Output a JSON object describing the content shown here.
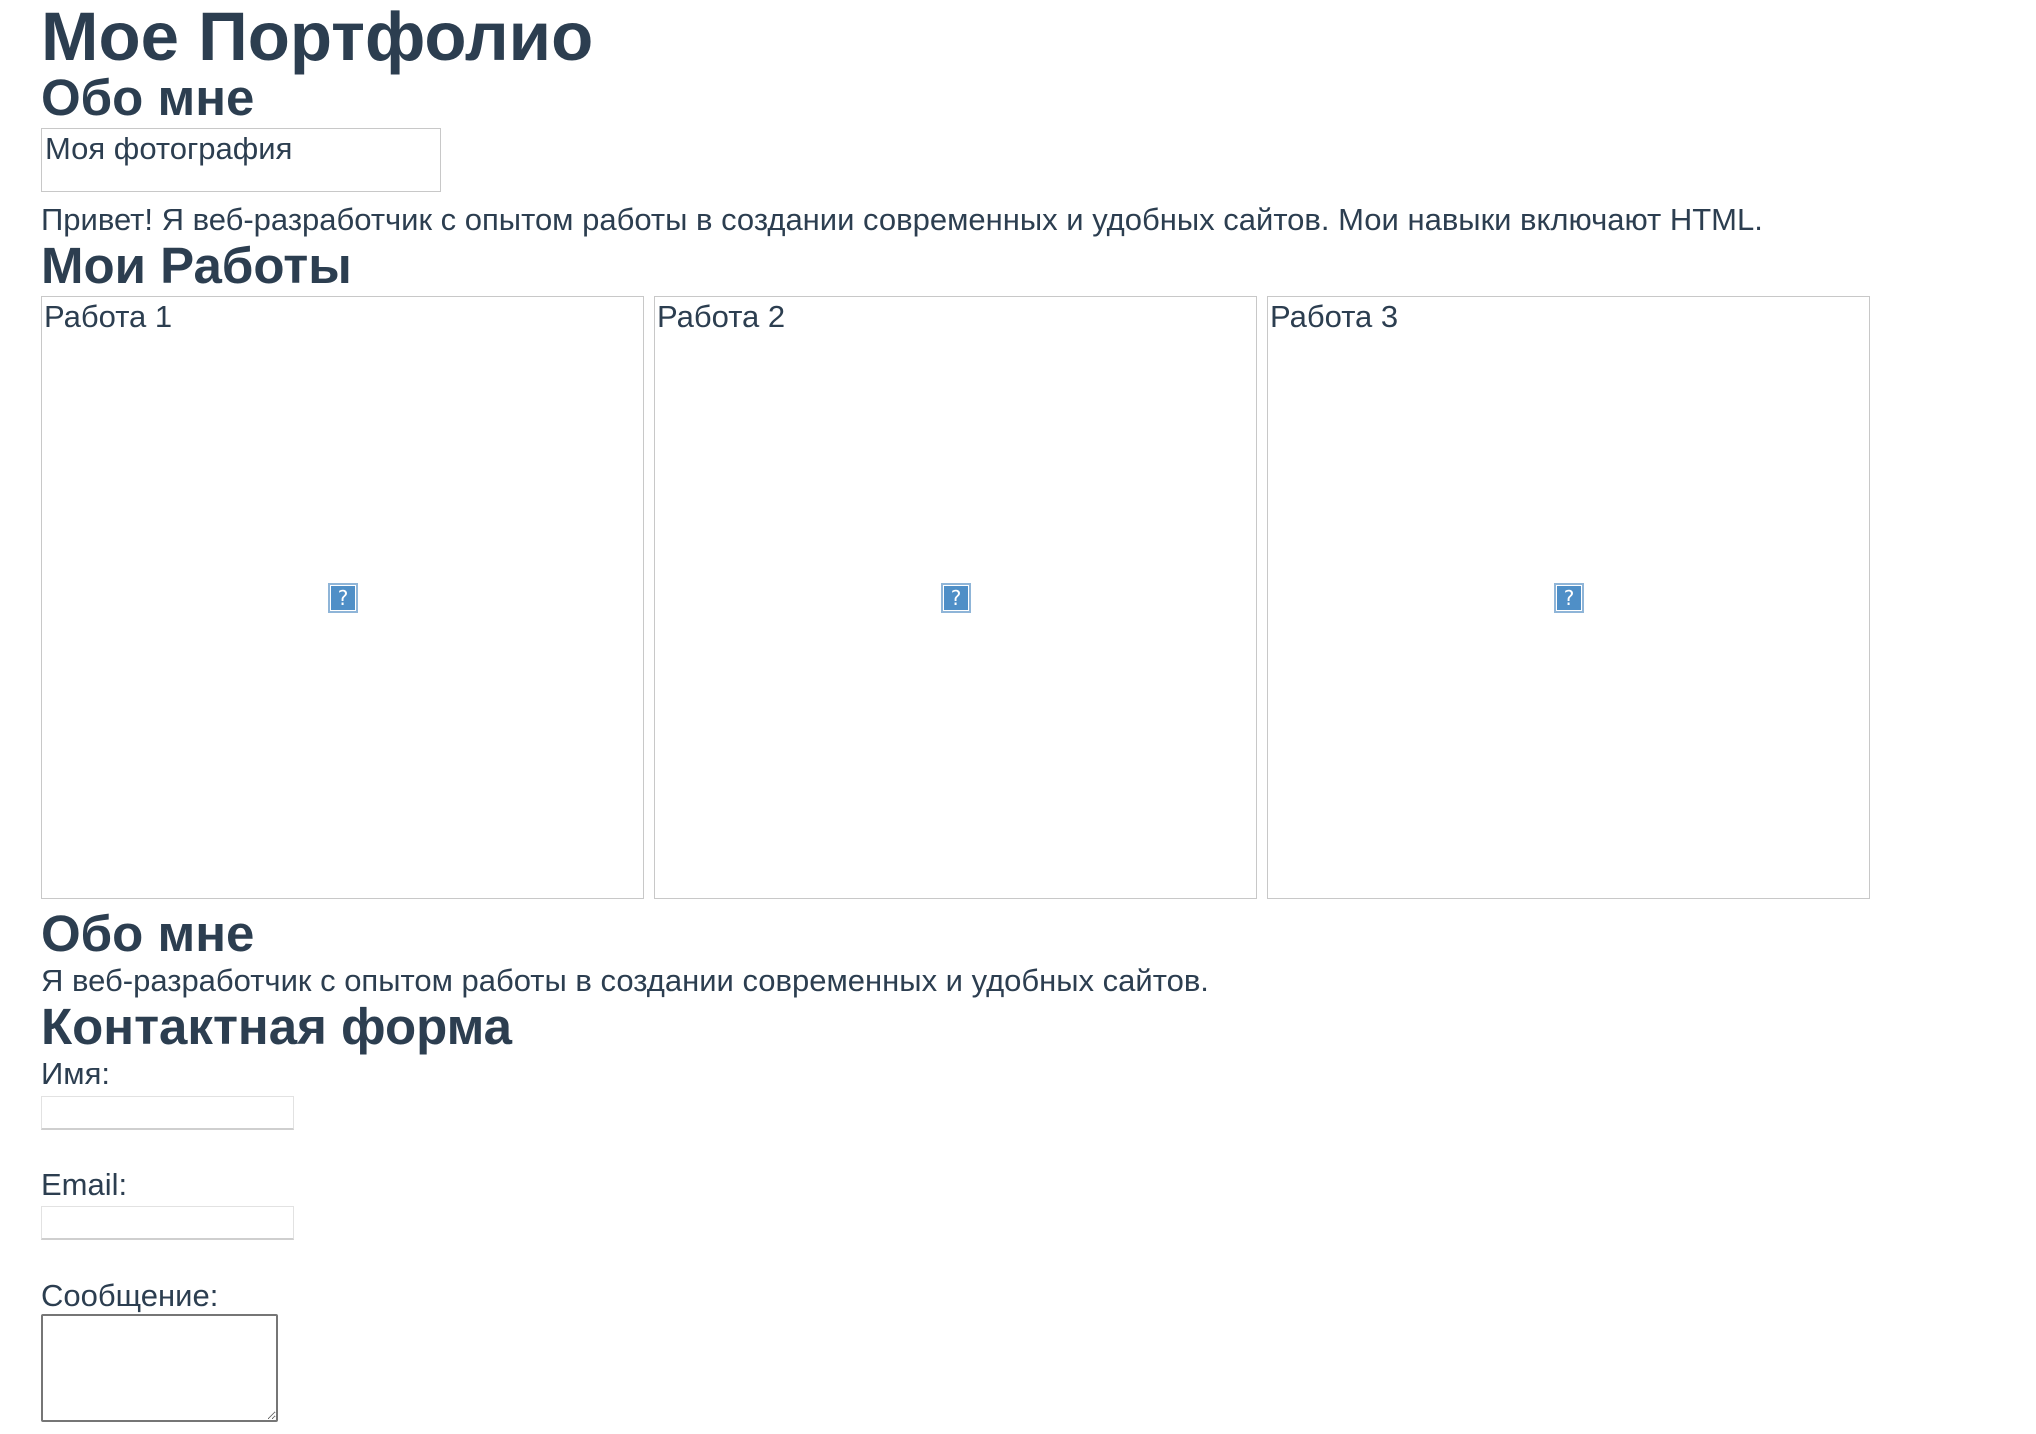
{
  "header": {
    "title": "Мое Портфолио"
  },
  "about": {
    "title": "Обо мне",
    "photo_alt": "Моя фотография",
    "intro": "Привет! Я веб-разработчик с опытом работы в создании современных и удобных сайтов. Мои навыки включают HTML."
  },
  "works": {
    "title": "Мои Работы",
    "items": [
      {
        "label": "Работа 1",
        "icon": "broken-image-icon"
      },
      {
        "label": "Работа 2",
        "icon": "broken-image-icon"
      },
      {
        "label": "Работа 3",
        "icon": "broken-image-icon"
      }
    ],
    "icon_glyph": "?"
  },
  "about_second": {
    "title": "Обо мне",
    "text": "Я веб-разработчик с опытом работы в создании современных и удобных сайтов."
  },
  "contact": {
    "title": "Контактная форма",
    "name_label": "Имя:",
    "name_value": "",
    "email_label": "Email:",
    "email_value": "",
    "message_label": "Сообщение:",
    "message_value": ""
  },
  "colors": {
    "text": "#2c3e50",
    "border": "#c8c8c8",
    "icon": "#4f8fc7"
  }
}
